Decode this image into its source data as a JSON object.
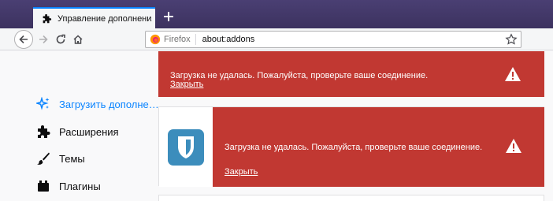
{
  "tab": {
    "title": "Управление дополнениями"
  },
  "urlbar": {
    "identity": "Firefox",
    "url": "about:addons"
  },
  "sidebar": {
    "items": [
      {
        "label": "Загрузить дополне…",
        "icon": "sparkle-icon",
        "selected": true
      },
      {
        "label": "Расширения",
        "icon": "puzzle-icon",
        "selected": false
      },
      {
        "label": "Темы",
        "icon": "brush-icon",
        "selected": false
      },
      {
        "label": "Плагины",
        "icon": "plugin-icon",
        "selected": false
      }
    ]
  },
  "cards": [
    {
      "message": "Загрузка не удалась. Пожалуйста, проверьте ваше соединение.",
      "link": "Закрыть"
    },
    {
      "message": "Загрузка не удалась. Пожалуйста, проверьте ваше соединение.",
      "link": "Закрыть",
      "addon_icon": "bitwarden-shield-icon"
    }
  ],
  "colors": {
    "error_bg": "#c13832",
    "accent": "#0a84ff",
    "tabstrip": "#433a6b",
    "addon_icon_bg": "#3c8dbc"
  }
}
